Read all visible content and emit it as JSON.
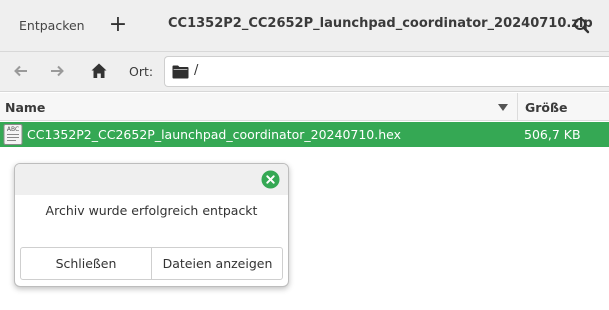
{
  "header": {
    "extract_label": "Entpacken",
    "add_label": "+",
    "title": "CC1352P2_CC2652P_launchpad_coordinator_20240710.zip",
    "search_icon": "search-icon"
  },
  "location": {
    "label": "Ort:",
    "path": "/",
    "icons": [
      "back-arrow-icon",
      "forward-arrow-icon",
      "home-icon",
      "folder-icon"
    ]
  },
  "columns": {
    "name": "Name",
    "size": "Größe"
  },
  "files": [
    {
      "name": "CC1352P2_CC2652P_launchpad_coordinator_20240710.hex",
      "size": "506,7 KB",
      "icon": "text-file-icon",
      "icon_text": "ABC",
      "selected": true
    }
  ],
  "dialog": {
    "message": "Archiv wurde erfolgreich entpackt",
    "close_label": "Schließen",
    "show_files_label": "Dateien anzeigen",
    "close_icon": "close-icon"
  },
  "colors": {
    "accent": "#35a854",
    "headerbar": "#efefef",
    "text": "#3a3a3a"
  }
}
